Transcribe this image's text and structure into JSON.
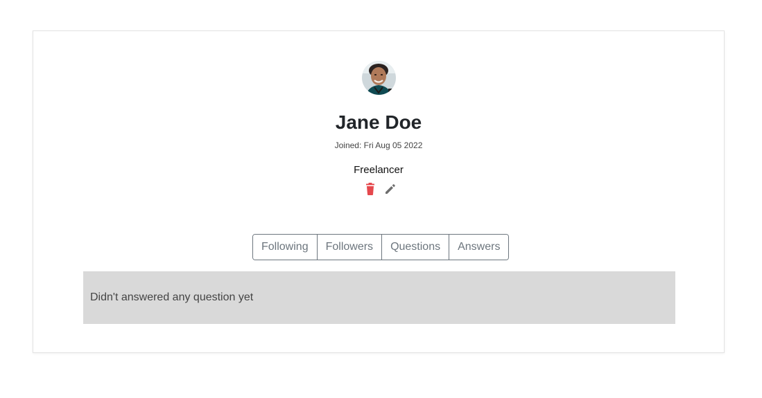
{
  "profile": {
    "name": "Jane Doe",
    "joined": "Joined: Fri Aug 05 2022",
    "role": "Freelancer",
    "avatar_icon": "user-avatar-photo"
  },
  "actions": {
    "delete_icon": "trash-icon",
    "edit_icon": "pencil-icon",
    "delete_color": "#e5484d",
    "edit_color": "#6e6e6e"
  },
  "tabs": [
    {
      "label": "Following"
    },
    {
      "label": "Followers"
    },
    {
      "label": "Questions"
    },
    {
      "label": "Answers"
    }
  ],
  "panel": {
    "message": "Didn't answered any question yet",
    "background": "#d9d9d9"
  }
}
